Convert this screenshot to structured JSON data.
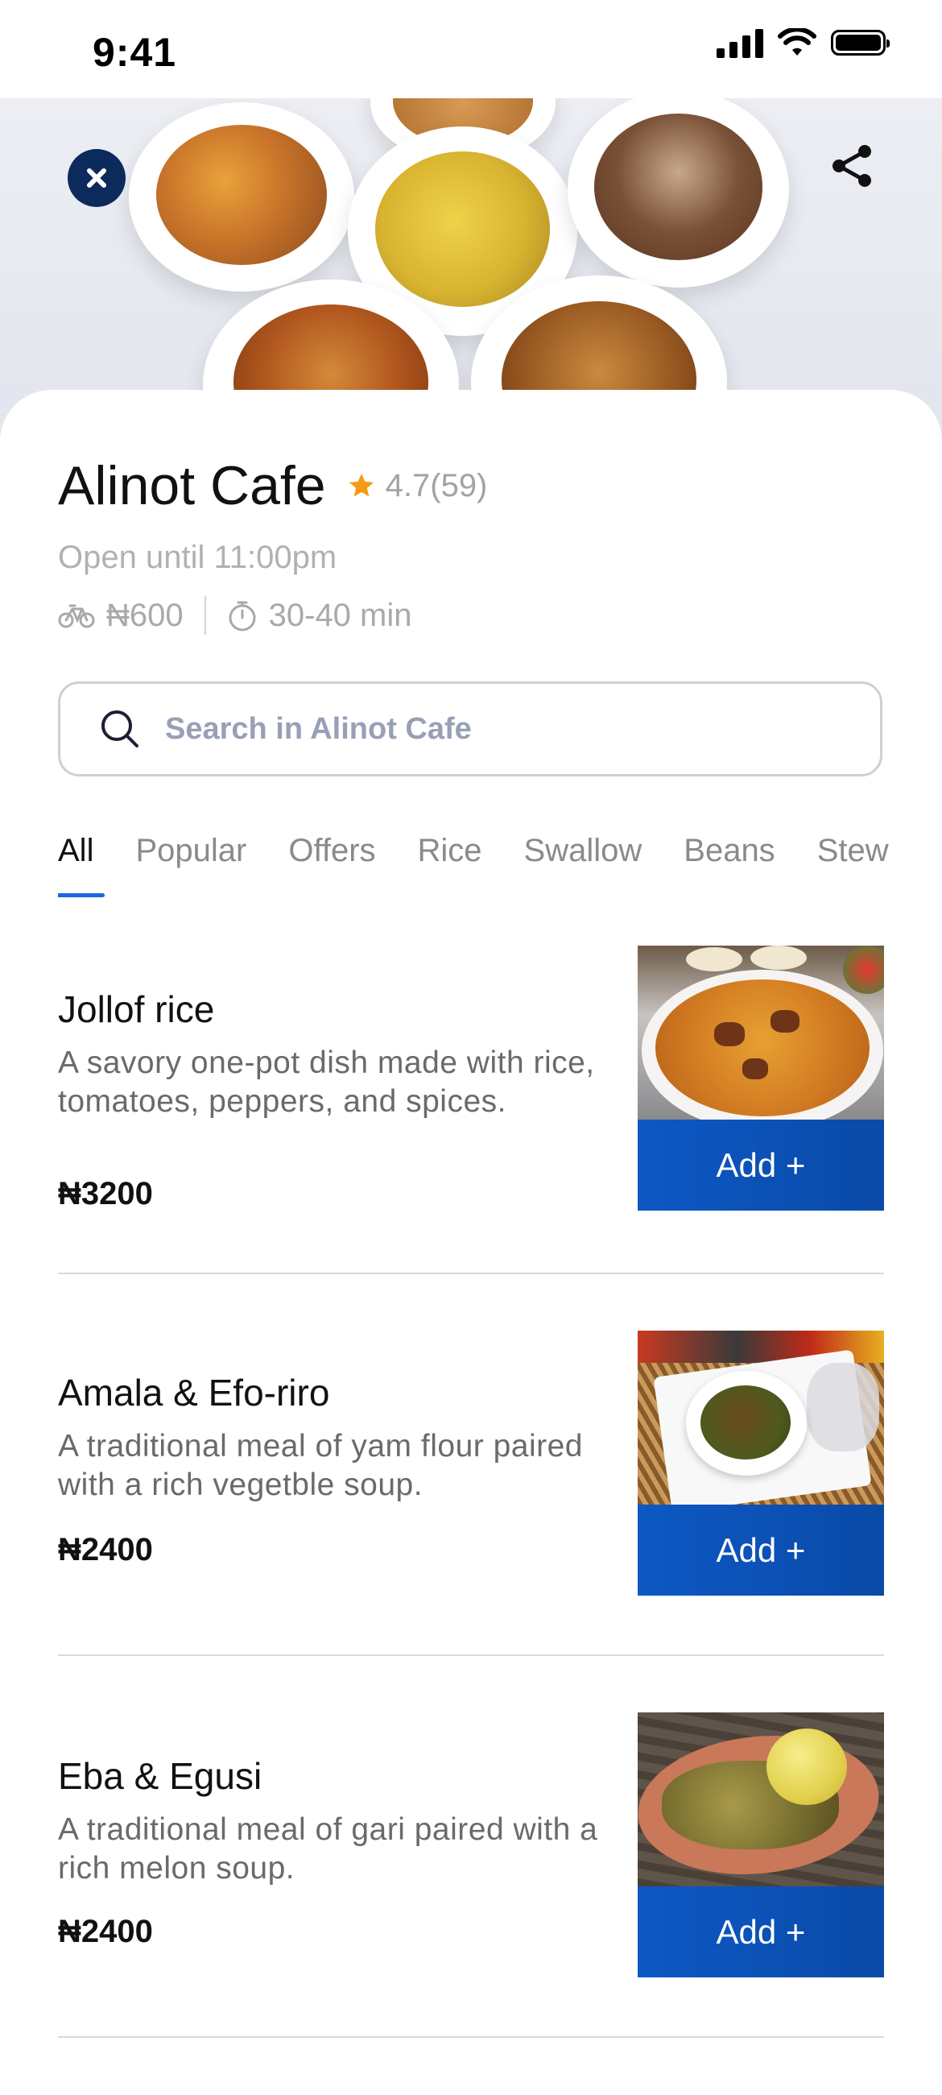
{
  "status_bar": {
    "time": "9:41"
  },
  "cafe": {
    "name": "Alinot Cafe",
    "rating": "4.7(59)",
    "open_until": "Open until 11:00pm",
    "delivery_fee": "₦600",
    "delivery_time": "30-40 min"
  },
  "search": {
    "placeholder": "Search in Alinot Cafe"
  },
  "tabs": [
    {
      "label": "All",
      "active": true
    },
    {
      "label": "Popular"
    },
    {
      "label": "Offers"
    },
    {
      "label": "Rice"
    },
    {
      "label": "Swallow"
    },
    {
      "label": "Beans"
    },
    {
      "label": "Stew"
    }
  ],
  "menu": [
    {
      "name": "Jollof rice",
      "description": "A savory one-pot dish made with rice, tomatoes, peppers, and spices.",
      "price": "₦3200",
      "add_label": "Add +"
    },
    {
      "name": "Amala & Efo-riro",
      "description": "A traditional meal of yam flour paired with a rich vegetble soup.",
      "price": "₦2400",
      "add_label": "Add +"
    },
    {
      "name": "Eba & Egusi",
      "description": "A traditional meal of gari paired with a rich melon soup.",
      "price": "₦2400",
      "add_label": "Add +"
    }
  ],
  "icons": {
    "close": "close-icon",
    "share": "share-icon",
    "star": "star-icon",
    "bike": "bicycle-icon",
    "timer": "stopwatch-icon",
    "search": "search-icon"
  },
  "colors": {
    "primary": "#0d58c4",
    "close_button": "#0d2a5c",
    "star": "#f59a16",
    "tab_underline": "#1a67e0"
  }
}
